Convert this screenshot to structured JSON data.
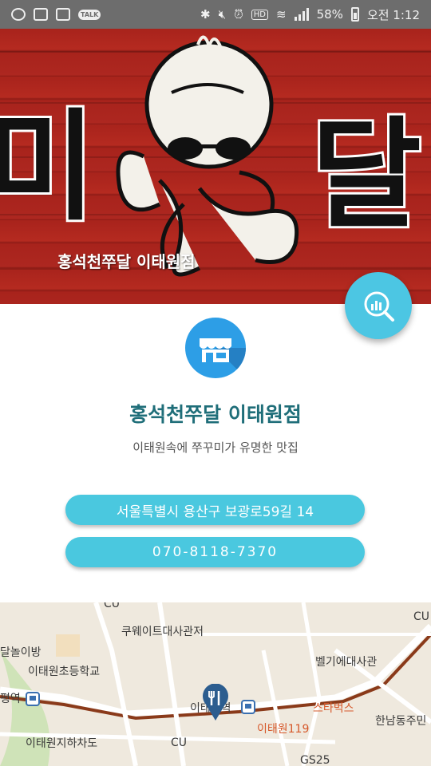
{
  "status_bar": {
    "battery": "58%",
    "time": "오전 1:12",
    "hd_label": "HD",
    "talk_label": "TALK"
  },
  "banner": {
    "caption": "홍석천쭈달 이태원점",
    "sign_left_char": "미",
    "sign_right_char": "달"
  },
  "store": {
    "name": "홍석천쭈달 이태원점",
    "description": "이태원속에 쭈꾸미가 유명한 맛집",
    "address": "서울특별시 용산구 보광로59길 14",
    "phone": "070-8118-7370"
  },
  "map": {
    "labels": [
      {
        "key": "cu_top",
        "text": "CU"
      },
      {
        "key": "kuwait",
        "text": "쿠웨이트대사관저"
      },
      {
        "key": "cu_right",
        "text": "CU"
      },
      {
        "key": "moon_room",
        "text": "달놀이방"
      },
      {
        "key": "school",
        "text": "이태원초등학교"
      },
      {
        "key": "belgium",
        "text": "벨기에대사관"
      },
      {
        "key": "station_left",
        "text": "평역"
      },
      {
        "key": "itaewon_station",
        "text": "이태원역"
      },
      {
        "key": "starbucks",
        "text": "스타벅스"
      },
      {
        "key": "hannam",
        "text": "한남동주민"
      },
      {
        "key": "itaewon119",
        "text": "이태원119"
      },
      {
        "key": "underpass",
        "text": "이태원지하차도"
      },
      {
        "key": "cu_bottom",
        "text": "CU"
      },
      {
        "key": "gs25",
        "text": "GS25"
      }
    ]
  },
  "colors": {
    "accent": "#4ac8df",
    "store_icon": "#2d9ee6",
    "title": "#1f6e79",
    "banner_red": "#a8231c"
  },
  "icons": {
    "fab": "search-chart-icon",
    "store": "storefront-icon"
  }
}
